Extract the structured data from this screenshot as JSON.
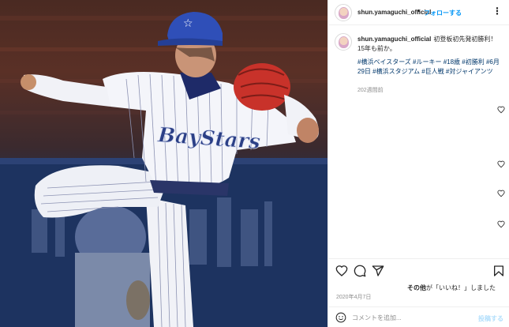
{
  "photo": {
    "alt_icon": "baseball-pitcher-photo",
    "jersey_text": "BayStars"
  },
  "header": {
    "username": "shun.yamaguchi_official",
    "dot": "•",
    "follow_label": "フォローする",
    "more_icon": "more-icon",
    "more_glyph": "⋮"
  },
  "caption": {
    "username": "shun.yamaguchi_official",
    "text": "初登板初先発初勝利！15年も前か。",
    "hashtags": "#横浜ベイスターズ #ルーキー #18歳 #初勝利 #6月29日 #横浜スタジアム #巨人戦 #対ジャイアンツ",
    "time": "202週間前"
  },
  "actions": {
    "like_icon": "heart-icon",
    "comment_icon": "comment-icon",
    "share_icon": "share-icon",
    "save_icon": "bookmark-icon"
  },
  "likes": {
    "prefix": "その他",
    "text": "が「いいね！」しました"
  },
  "date": "2020年4月7日",
  "comment_box": {
    "emoji_icon": "emoji-icon",
    "placeholder": "コメントを追加...",
    "post_label": "投稿する"
  },
  "colors": {
    "accent": "#0095f6",
    "hashtag": "#00376b",
    "muted": "#8e8e8e",
    "post_disabled": "#b2dffc"
  }
}
